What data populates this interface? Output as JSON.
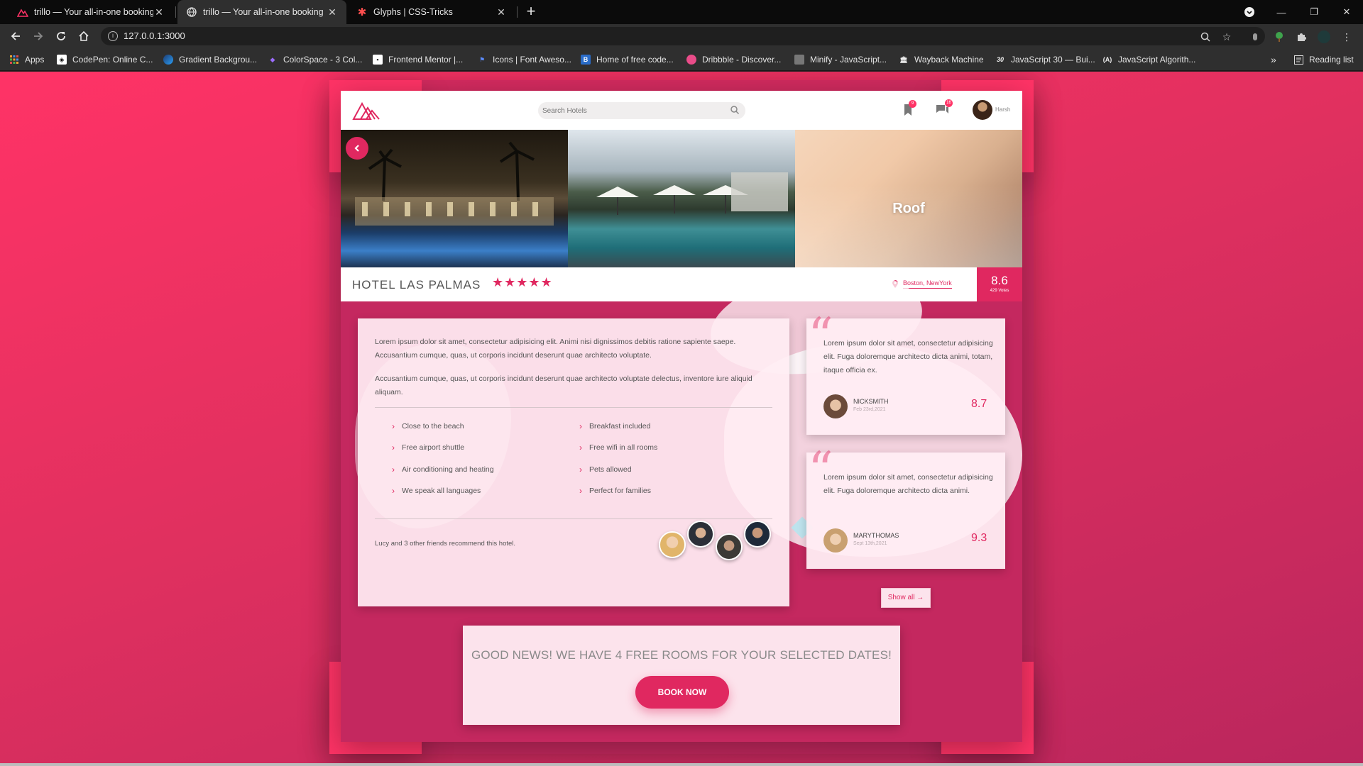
{
  "browser": {
    "tabs": [
      {
        "title": "trillo — Your all-in-one booking"
      },
      {
        "title": "trillo — Your all-in-one booking"
      },
      {
        "title": "Glyphs | CSS-Tricks"
      }
    ],
    "url": "127.0.0.1:3000",
    "bookmarks": [
      {
        "label": "Apps",
        "icon": "apps-grid-icon"
      },
      {
        "label": "CodePen: Online C...",
        "icon": "codepen-icon"
      },
      {
        "label": "Gradient Backgrou...",
        "icon": "gradient-icon"
      },
      {
        "label": "ColorSpace - 3 Col...",
        "icon": "colorspace-icon"
      },
      {
        "label": "Frontend Mentor |...",
        "icon": "frontend-mentor-icon"
      },
      {
        "label": "Icons | Font Aweso...",
        "icon": "font-awesome-flag-icon"
      },
      {
        "label": "Home of free code...",
        "icon": "codepad-icon"
      },
      {
        "label": "Dribbble - Discover...",
        "icon": "dribbble-icon"
      },
      {
        "label": "Minify - JavaScript...",
        "icon": "minify-icon"
      },
      {
        "label": "Wayback Machine",
        "icon": "wayback-icon"
      },
      {
        "label": "JavaScript 30 — Bui...",
        "icon": "js30-icon"
      },
      {
        "label": "JavaScript Algorith...",
        "icon": "js-algorithms-icon"
      }
    ],
    "reading_list": "Reading list",
    "overflow": "»"
  },
  "app": {
    "search_placeholder": "Search Hotels",
    "bookmarks_badge": "9",
    "chat_badge": "16",
    "user_name": "Harsh",
    "gallery_label": "Roof",
    "hotel_name": "HOTEL LAS PALMAS",
    "stars": "★★★★★",
    "location": "Boston, NewYork",
    "rating": "8.6",
    "votes": "429 Votes",
    "description": [
      "Lorem ipsum dolor sit amet, consectetur adipisicing elit. Animi nisi dignissimos debitis ratione sapiente saepe. Accusantium cumque, quas, ut corporis incidunt deserunt quae architecto voluptate.",
      "Accusantium cumque, quas, ut corporis incidunt deserunt quae architecto voluptate delectus, inventore iure aliquid aliquam."
    ],
    "features": [
      "Close to the beach",
      "Breakfast included",
      "Free airport shuttle",
      "Free wifi in all rooms",
      "Air conditioning and heating",
      "Pets allowed",
      "We speak all languages",
      "Perfect for families"
    ],
    "recommend_text": "Lucy and 3 other friends recommend this hotel.",
    "reviews": [
      {
        "text": "Lorem ipsum dolor sit amet, consectetur adipisicing elit. Fuga doloremque architecto dicta animi, totam, itaque officia ex.",
        "name": "NICKSMITH",
        "date": "Feb 23rd,2021",
        "score": "8.7"
      },
      {
        "text": "Lorem ipsum dolor sit amet, consectetur adipisicing elit. Fuga doloremque architecto dicta animi.",
        "name": "MARYTHOMAS",
        "date": "Sept 13th,2021",
        "score": "9.3"
      }
    ],
    "show_all": "Show all →",
    "cta_text": "GOOD NEWS! WE HAVE 4 FREE ROOMS FOR YOUR SELECTED DATES!",
    "book_now": "BOOK NOW",
    "colors": {
      "primary": "#e02860",
      "primary_light": "#ff3366",
      "primary_dark": "#ba265d"
    }
  }
}
